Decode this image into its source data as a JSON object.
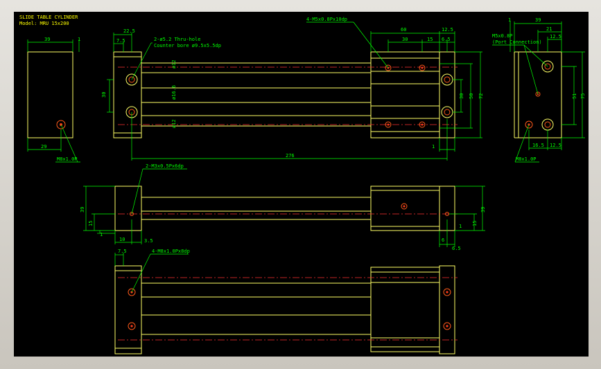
{
  "title": {
    "line1": "SLIDE TABLE CYLINDER",
    "line2": "Model: MRU 15x200"
  },
  "colors": {
    "background": "#000000",
    "outline": "#ffff66",
    "dimension": "#00ff00",
    "centerline": "#ff3030",
    "hole": "#ff5a1a"
  },
  "dims": {
    "d39_left": "39",
    "d1_left": "1",
    "d29": "29",
    "d22_5": "22.5",
    "d7_5_top": "7.5",
    "d30_left": "30",
    "d60": "60",
    "d12_5_top": "12.5",
    "d30_right": "30",
    "d15": "15",
    "d6_5_top": "6.5",
    "d30_vert": "30",
    "d50": "50",
    "d72": "72",
    "d276": "276",
    "d1_bottom": "1",
    "d1_rside": "1",
    "d39_rside": "39",
    "d21": "21",
    "d12_5_rside": "12.5",
    "d51": "51",
    "d75": "75",
    "d16_5": "16.5",
    "d12_5_rbot": "12.5",
    "rod_phi12_a": "ø12",
    "rod_phi16_6": "ø16.6",
    "rod_phi12_b": "ø12",
    "d39_front": "39",
    "d15_front": "15",
    "d1_front": "1",
    "d10": "10",
    "d3_5": "3.5",
    "d39_front_r": "39",
    "d15_front_r": "15",
    "d1_front_r": "1",
    "d6": "6",
    "d6_5_front": "6.5",
    "d7_5_bottom": "7.5"
  },
  "callouts": {
    "thru_hole": "2-ø5.2 Thru-hole",
    "counter_bore": "Counter bore ø9.5x5.5dp",
    "m5_top": "4-M5x0.8Px10dp",
    "m8_left": "M8x1.0P",
    "m5_port": "M5x0.8P",
    "port_connection": "(Port Connection)",
    "m8_right": "M8x1.0P",
    "m3": "2-M3x0.5Px6dp",
    "m8_bottom": "4-M8x1.0Px8dp"
  }
}
